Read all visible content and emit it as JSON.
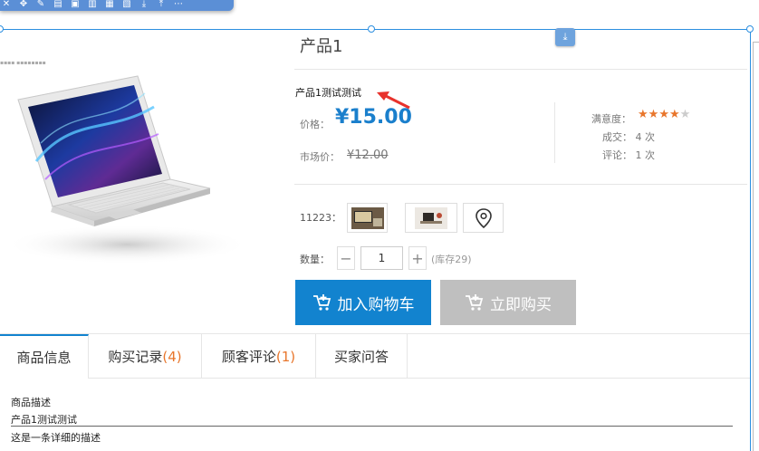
{
  "product": {
    "title": "产品1",
    "subtitle": "产品1测试测试",
    "price_label": "价格：",
    "price": "¥15.00",
    "market_price_label": "市场价：",
    "market_price": "¥12.00"
  },
  "stats": {
    "satisfaction_label": "满意度：",
    "rating": 4,
    "rating_max": 5,
    "deals_text": "成交： 4 次",
    "reviews_text": "评论： 1 次"
  },
  "spec": {
    "label": "11223："
  },
  "quantity": {
    "label": "数量：",
    "minus": "−",
    "plus": "+",
    "value": "1",
    "stock": "(库存29)"
  },
  "buttons": {
    "add_to_cart": "加入购物车",
    "buy_now": "立即购买"
  },
  "tabs": [
    {
      "label": "商品信息",
      "count": ""
    },
    {
      "label": "购买记录 ",
      "count": "(4)"
    },
    {
      "label": "顾客评论 ",
      "count": "(1)"
    },
    {
      "label": "买家问答",
      "count": ""
    }
  ],
  "description": {
    "heading": "商品描述",
    "line1": "产品1测试测试",
    "line2": "这是一条详细的描述"
  },
  "colors": {
    "accent": "#1283cf",
    "star": "#e8762c",
    "disabled": "#bfbfbf"
  }
}
